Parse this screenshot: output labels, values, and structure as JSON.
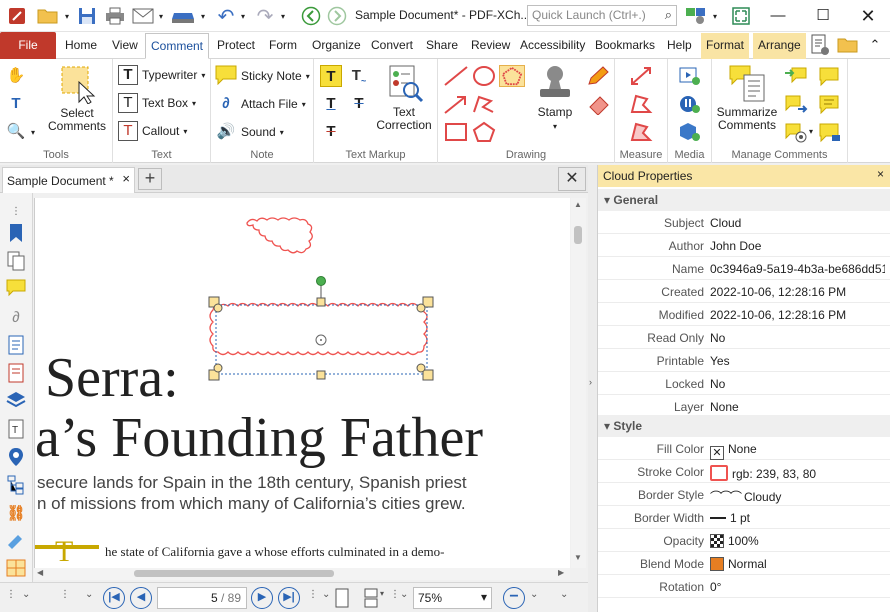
{
  "window": {
    "title": "Sample Document* - PDF-XCh...",
    "quick_launch_placeholder": "Quick Launch (Ctrl+.)",
    "search_icon": "magnifier-icon"
  },
  "tabs": {
    "file": "File",
    "items": [
      "Home",
      "View",
      "Comment",
      "Protect",
      "Form",
      "Organize",
      "Convert",
      "Share",
      "Review",
      "Accessibility",
      "Bookmarks",
      "Help"
    ],
    "contextual": [
      "Format",
      "Arrange"
    ],
    "active": "Comment"
  },
  "ribbon": {
    "groups": [
      "Tools",
      "Text",
      "Note",
      "Text Markup",
      "Drawing",
      "Measure",
      "Media",
      "Manage Comments"
    ],
    "select_comments": "Select Comments",
    "typewriter": "Typewriter",
    "text_box": "Text Box",
    "callout": "Callout",
    "sticky_note": "Sticky Note",
    "attach_file": "Attach File",
    "sound": "Sound",
    "text_correction": "Text Correction",
    "stamp": "Stamp",
    "summarize_comments": "Summarize Comments"
  },
  "document": {
    "tab_label": "Sample Document *",
    "heading1": "Serra:",
    "heading2": "a’s Founding Father",
    "body1": "secure lands for Spain in the 18th century, Spanish priest",
    "body2": "n of missions from which many of California’s cities grew.",
    "body3": "he state of California gave a     whose efforts culminated in a demo-",
    "drop_cap": "T"
  },
  "statusbar": {
    "page_current": "5",
    "page_total": "89",
    "zoom": "75%"
  },
  "properties": {
    "title": "Cloud Properties",
    "general_label": "General",
    "style_label": "Style",
    "general": [
      {
        "k": "Subject",
        "v": "Cloud"
      },
      {
        "k": "Author",
        "v": "John Doe"
      },
      {
        "k": "Name",
        "v": "0c3946a9-5a19-4b3a-be686dd51..."
      },
      {
        "k": "Created",
        "v": "2022-10-06, 12:28:16 PM"
      },
      {
        "k": "Modified",
        "v": "2022-10-06, 12:28:16 PM"
      },
      {
        "k": "Read Only",
        "v": "No"
      },
      {
        "k": "Printable",
        "v": "Yes"
      },
      {
        "k": "Locked",
        "v": "No"
      },
      {
        "k": "Layer",
        "v": "None"
      }
    ],
    "style": [
      {
        "k": "Fill Color",
        "v": "None"
      },
      {
        "k": "Stroke Color",
        "v": "rgb: 239, 83, 80"
      },
      {
        "k": "Border Style",
        "v": "Cloudy"
      },
      {
        "k": "Border Width",
        "v": "1 pt"
      },
      {
        "k": "Opacity",
        "v": "100%"
      },
      {
        "k": "Blend Mode",
        "v": "Normal"
      },
      {
        "k": "Rotation",
        "v": "0°"
      }
    ],
    "stroke_color_hex": "#ef5350",
    "blend_color_hex": "#e67e22"
  },
  "colors": {
    "file_tab": "#c0392b",
    "accent_blue": "#2a64b5",
    "cloud_stroke": "#ef5350",
    "panel_title_bg": "#fae6a6"
  }
}
